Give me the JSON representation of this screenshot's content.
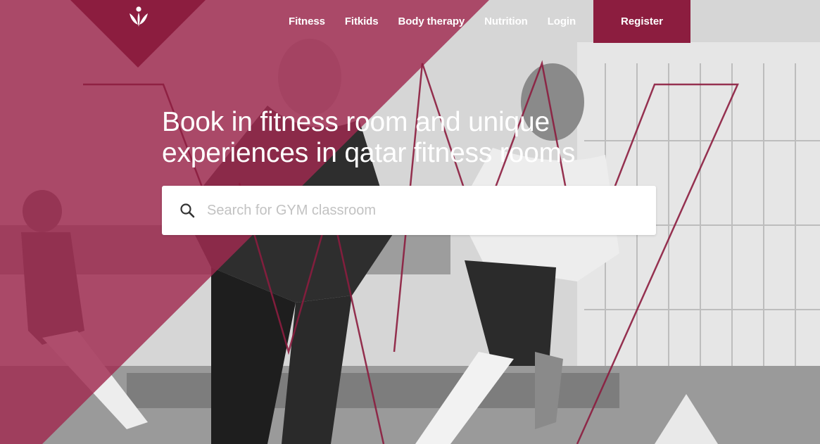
{
  "brand": {
    "logo_icon": "person-leaf-logo-icon",
    "accent_color": "#8c1d3f",
    "overlay_color": "#a0294f"
  },
  "nav": {
    "items": [
      {
        "label": "Fitness"
      },
      {
        "label": "Fitkids"
      },
      {
        "label": "Body therapy"
      },
      {
        "label": "Nutrition"
      },
      {
        "label": "Login"
      }
    ],
    "register_label": "Register"
  },
  "hero": {
    "headline_line1": "Book in fitness room and unique",
    "headline_line2": "experiences in qatar fitness rooms",
    "search": {
      "placeholder": "Search for GYM classroom",
      "value": "",
      "icon": "search-icon"
    }
  }
}
